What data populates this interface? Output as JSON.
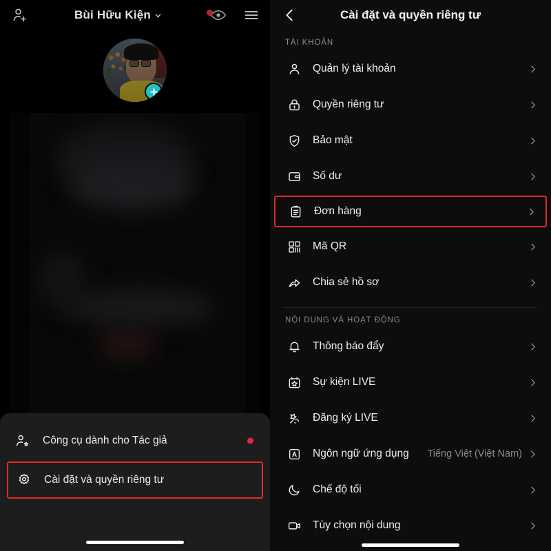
{
  "left_panel": {
    "header": {
      "add_user_icon": "add-user-icon",
      "profile_name": "Bùi Hữu Kiện",
      "caret_icon": "chevron-down-icon",
      "notification_dot": true,
      "eye_icon": "eye-icon",
      "menu_icon": "hamburger-menu-icon"
    },
    "avatar": {
      "add_badge_icon": "plus-icon",
      "badge_color": "#20c0c7"
    },
    "bottom_sheet": {
      "rows": [
        {
          "label": "Công cụ dành cho Tác giả",
          "icon": "creator-tools-icon",
          "has_dot": true,
          "dot_color": "#e0294a",
          "highlighted": false
        },
        {
          "label": "Cài đặt và quyền riêng tư",
          "icon": "gear-icon",
          "has_dot": false,
          "highlighted": true
        }
      ]
    }
  },
  "right_panel": {
    "header": {
      "back_icon": "chevron-left-icon",
      "title": "Cài đặt và quyền riêng tư"
    },
    "sections": [
      {
        "label": "TÀI KHOẢN",
        "rows": [
          {
            "label": "Quản lý tài khoản",
            "icon": "person-icon",
            "value": "",
            "highlighted": false
          },
          {
            "label": "Quyền riêng tư",
            "icon": "lock-icon",
            "value": "",
            "highlighted": false
          },
          {
            "label": "Bảo mật",
            "icon": "shield-check-icon",
            "value": "",
            "highlighted": false
          },
          {
            "label": "Số dư",
            "icon": "wallet-icon",
            "value": "",
            "highlighted": false
          },
          {
            "label": "Đơn hàng",
            "icon": "clipboard-icon",
            "value": "",
            "highlighted": true
          },
          {
            "label": "Mã QR",
            "icon": "qr-code-icon",
            "value": "",
            "highlighted": false
          },
          {
            "label": "Chia sẻ hồ sơ",
            "icon": "share-arrow-icon",
            "value": "",
            "highlighted": false
          }
        ]
      },
      {
        "label": "NỘI DUNG VÀ HOẠT ĐỘNG",
        "rows": [
          {
            "label": "Thông báo đẩy",
            "icon": "bell-icon",
            "value": "",
            "highlighted": false
          },
          {
            "label": "Sự kiện LIVE",
            "icon": "calendar-star-icon",
            "value": "",
            "highlighted": false
          },
          {
            "label": "Đăng ký LIVE",
            "icon": "live-star-icon",
            "value": "",
            "highlighted": false
          },
          {
            "label": "Ngôn ngữ ứng dụng",
            "icon": "language-a-icon",
            "value": "Tiếng Việt (Việt Nam)",
            "highlighted": false
          },
          {
            "label": "Chế độ tối",
            "icon": "moon-icon",
            "value": "",
            "highlighted": false
          },
          {
            "label": "Tùy chọn nội dung",
            "icon": "video-camera-icon",
            "value": "",
            "highlighted": false
          }
        ]
      }
    ],
    "chevron_icon": "chevron-right-icon"
  },
  "colors": {
    "highlight_border": "#e02a2a",
    "accent_teal": "#20c0c7",
    "notification_red": "#e0294a",
    "panel_bg": "#0d0d0d",
    "sheet_bg": "#1d1d1d"
  }
}
